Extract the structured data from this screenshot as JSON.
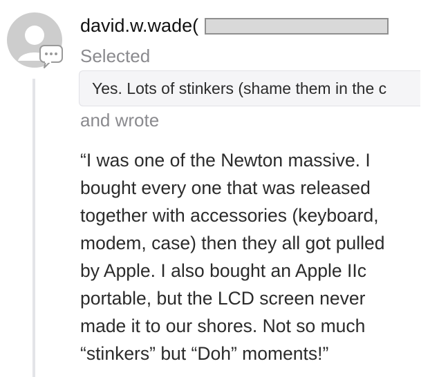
{
  "comment": {
    "author": "david.w.wade(",
    "selected_label": "Selected",
    "selected_quote": "Yes. Lots of stinkers (shame them in the c",
    "wrote_label": "and wrote",
    "body_lines": [
      "“I was one of the Newton massive. I",
      "bought every one that was released",
      "together with accessories (keyboard,",
      "modem, case) then they all got pulled",
      "by Apple. I also bought an Apple IIc",
      "portable, but the LCD screen never",
      "made it to our shores. Not so much",
      "“stinkers” but “Doh” moments!”"
    ]
  },
  "icons": {
    "avatar": "default-user-avatar-icon",
    "comment_badge": "comment-bubble-icon"
  },
  "colors": {
    "avatar_gray": "#cdcdcd",
    "muted_text": "#8a8a8e",
    "thread_line": "#e3e4e8",
    "quote_bg": "#f5f5f7",
    "redaction": "#d9d9d9"
  }
}
